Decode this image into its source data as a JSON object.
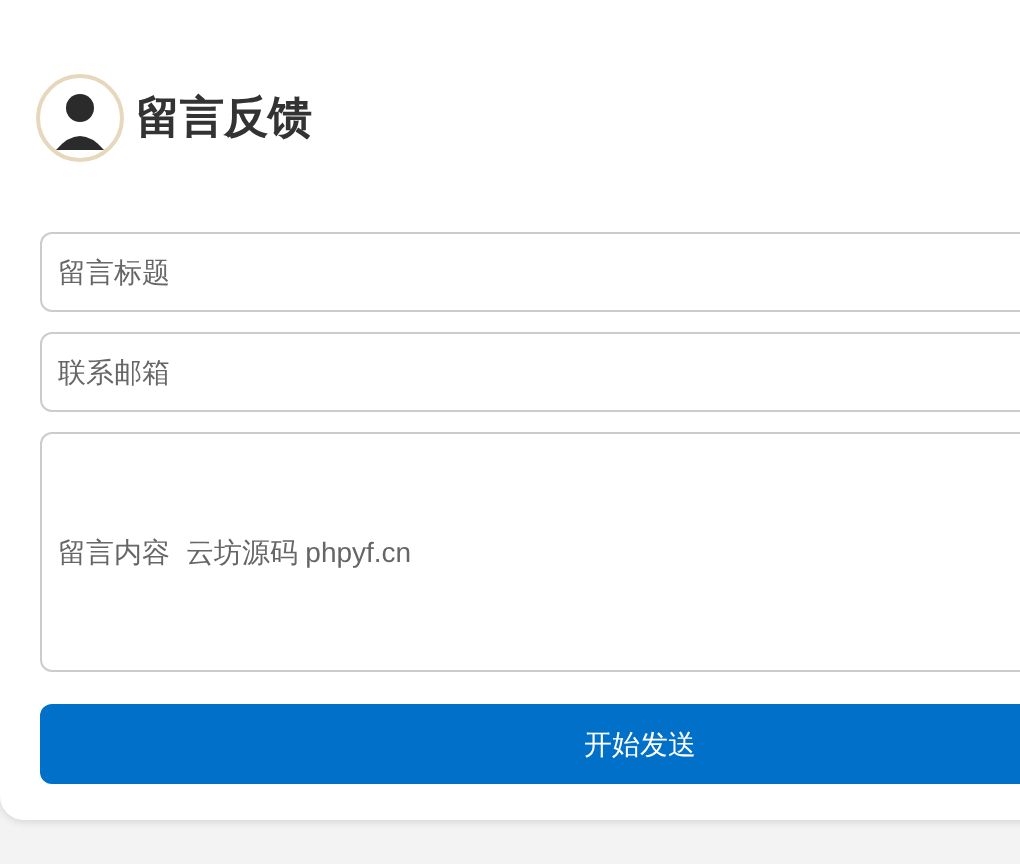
{
  "header": {
    "title": "留言反馈"
  },
  "fields": [
    {
      "kind": "input",
      "placeholder": "留言标题"
    },
    {
      "kind": "input",
      "placeholder": "联系邮箱"
    },
    {
      "kind": "textarea",
      "placeholder": "留言内容  云坊源码 phpyf.cn"
    }
  ],
  "submit_button": {
    "label": "开始发送"
  }
}
